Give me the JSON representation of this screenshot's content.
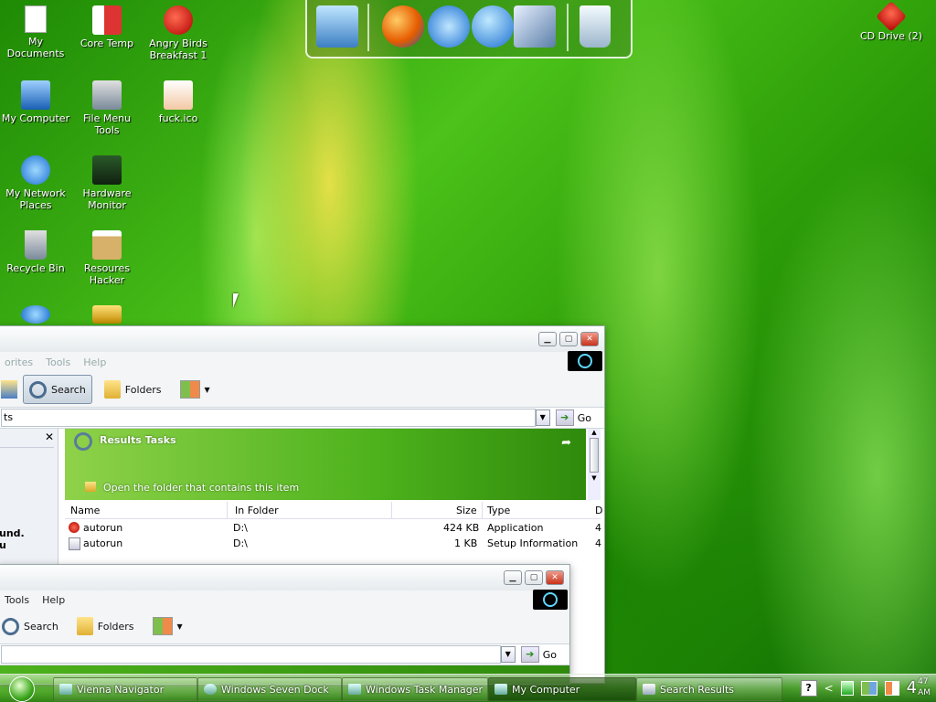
{
  "desktop": {
    "icons": [
      {
        "label": "My Documents"
      },
      {
        "label": "Core Temp"
      },
      {
        "label": "Angry Birds Breakfast 1"
      },
      {
        "label": "My Computer"
      },
      {
        "label": "File Menu Tools"
      },
      {
        "label": "fuck.ico"
      },
      {
        "label": "My Network Places"
      },
      {
        "label": "Hardware Monitor"
      },
      {
        "label": "Recycle Bin"
      },
      {
        "label": "Resoures Hacker"
      },
      {
        "label": "CD Drive (2)"
      }
    ]
  },
  "window1": {
    "menu": [
      "orites",
      "Tools",
      "Help"
    ],
    "toolbar": {
      "search": "Search",
      "folders": "Folders"
    },
    "address": {
      "value": "ts",
      "go": "Go"
    },
    "left_pane": {
      "text_line1": "und.",
      "text_line2": "u"
    },
    "results_tasks": {
      "title": "Results Tasks",
      "task": "Open the folder that contains this item"
    },
    "columns": [
      "Name",
      "In Folder",
      "Size",
      "Type",
      "D"
    ],
    "rows": [
      {
        "name": "autorun",
        "folder": "D:\\",
        "size": "424 KB",
        "type": "Application",
        "extra": "4"
      },
      {
        "name": "autorun",
        "folder": "D:\\",
        "size": "1 KB",
        "type": "Setup Information",
        "extra": "4"
      }
    ]
  },
  "window2": {
    "menu": [
      "Tools",
      "Help"
    ],
    "toolbar": {
      "search": "Search",
      "folders": "Folders"
    },
    "address": {
      "go": "Go"
    }
  },
  "taskbar": {
    "tasks": [
      {
        "label": "Vienna Navigator"
      },
      {
        "label": "Windows Seven Dock"
      },
      {
        "label": "Windows Task Manager"
      },
      {
        "label": "My Computer"
      },
      {
        "label": "Search Results"
      }
    ],
    "clock": {
      "hour": "4",
      "minute": "47",
      "ampm": "AM"
    },
    "help_glyph": "?",
    "tray_arrow": "<"
  }
}
